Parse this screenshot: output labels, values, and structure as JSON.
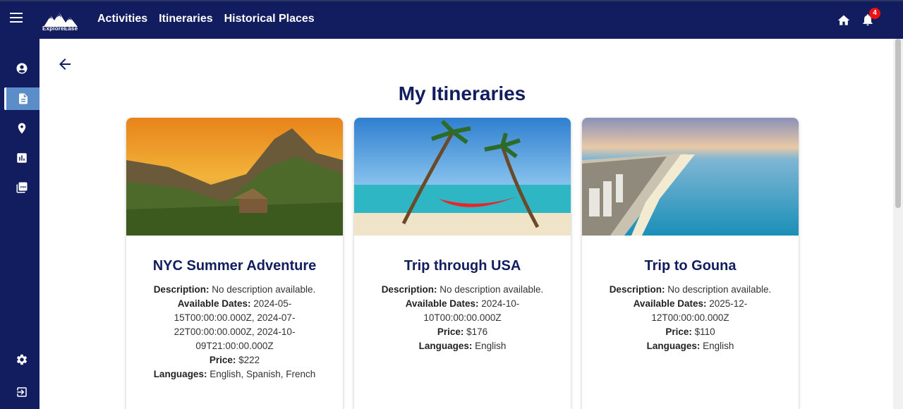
{
  "header": {
    "logo_text": "ExploreEase",
    "nav": [
      "Activities",
      "Itineraries",
      "Historical Places"
    ],
    "notification_count": "4"
  },
  "sidebar": {
    "items": [
      "profile-icon",
      "document-icon",
      "location-icon",
      "chart-icon",
      "pdf-icon",
      "settings-icon",
      "logout-icon"
    ],
    "active_index": 1
  },
  "page": {
    "title": "My Itineraries"
  },
  "labels": {
    "description": "Description:",
    "dates": "Available Dates:",
    "price": "Price:",
    "languages": "Languages:"
  },
  "cards": [
    {
      "title": "NYC Summer Adventure",
      "description": "No description available.",
      "dates": "2024-05-15T00:00:00.000Z, 2024-07-22T00:00:00.000Z, 2024-10-09T21:00:00.000Z",
      "price": "$222",
      "languages": "English, Spanish, French"
    },
    {
      "title": "Trip through USA",
      "description": "No description available.",
      "dates": "2024-10-10T00:00:00.000Z",
      "price": "$176",
      "languages": "English"
    },
    {
      "title": "Trip to Gouna",
      "description": "No description available.",
      "dates": "2025-12-12T00:00:00.000Z",
      "price": "$110",
      "languages": "English"
    }
  ],
  "colors": {
    "primary": "#111d5e",
    "sidebar_active": "#5b8ec9",
    "badge": "#ee1111",
    "delete": "#d32f2f"
  }
}
